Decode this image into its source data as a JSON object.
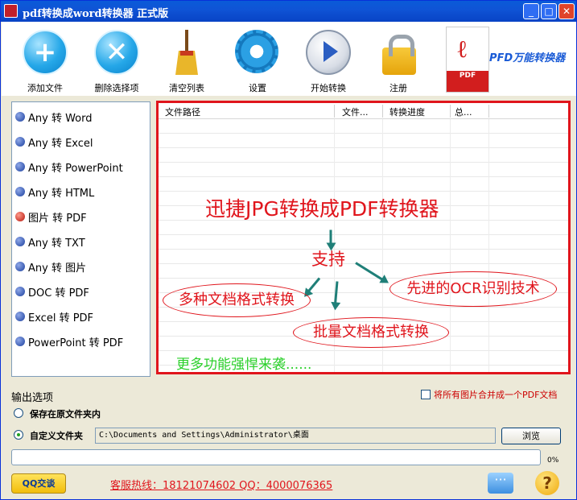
{
  "window": {
    "title": "pdf转换成word转换器 正式版",
    "minimize": "_",
    "maximize": "□",
    "close": "✕"
  },
  "toolbar": {
    "add": "添加文件",
    "delete": "删除选择项",
    "clear": "清空列表",
    "settings": "设置",
    "start": "开始转换",
    "register": "注册",
    "brand": "PFD万能转换器",
    "pdf_badge": "PDF"
  },
  "modes": [
    {
      "label": "Any 转 Word",
      "selected": false
    },
    {
      "label": "Any 转 Excel",
      "selected": false
    },
    {
      "label": "Any 转 PowerPoint",
      "selected": false
    },
    {
      "label": "Any 转 HTML",
      "selected": false
    },
    {
      "label": "图片 转 PDF",
      "selected": true
    },
    {
      "label": "Any 转 TXT",
      "selected": false
    },
    {
      "label": "Any 转 图片",
      "selected": false
    },
    {
      "label": "DOC 转 PDF",
      "selected": false
    },
    {
      "label": "Excel 转 PDF",
      "selected": false
    },
    {
      "label": "PowerPoint 转 PDF",
      "selected": false
    }
  ],
  "table": {
    "columns": [
      "文件路径",
      "文件...",
      "转换进度",
      "总..."
    ]
  },
  "promo": {
    "headline": "迅捷JPG转换成PDF转换器",
    "support": "支持",
    "multi": "多种文档格式转换",
    "ocr": "先进的OCR识别技术",
    "batch": "批量文档格式转换",
    "more": "更多功能强悍来袭......"
  },
  "output": {
    "title": "输出选项",
    "merge": "将所有图片合并成一个PDF文档",
    "merge_checked": false,
    "keep_original": "保存在原文件夹内",
    "custom_folder": "自定义文件夹",
    "selected_option": "custom_folder",
    "path": "C:\\Documents and Settings\\Administrator\\桌面",
    "browse": "浏览"
  },
  "progress": {
    "value": 0,
    "text": "0%"
  },
  "footer": {
    "qq": "QQ交谈",
    "hotline": "客服热线：18121074602 QQ：4000076365"
  }
}
